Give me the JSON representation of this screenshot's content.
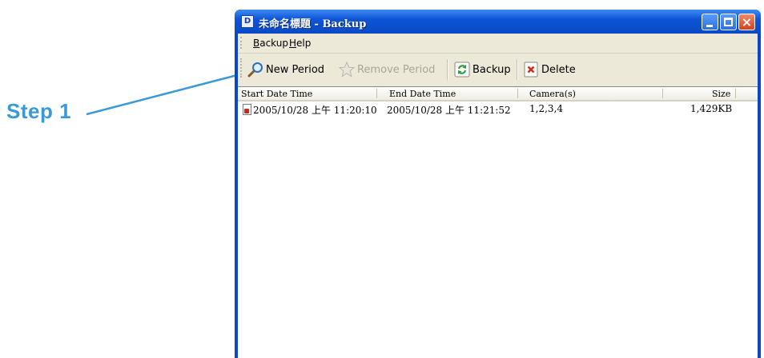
{
  "annotation": {
    "step_label": "Step 1"
  },
  "window": {
    "title": "未命名標題 - Backup",
    "app_icon": "D"
  },
  "menu": {
    "items": [
      {
        "label_accel": "B",
        "label_rest": "ackup"
      },
      {
        "label_accel": "H",
        "label_rest": "elp"
      }
    ]
  },
  "toolbar": {
    "new_period_label": "New Period",
    "remove_period_label": "Remove Period",
    "backup_label": "Backup",
    "delete_label": "Delete",
    "icons": {
      "new_period": "magnifier-icon",
      "remove_period": "star-icon",
      "backup": "refresh-icon",
      "delete": "delete-x-icon"
    }
  },
  "list": {
    "columns": [
      "Start Date Time",
      "End Date Time",
      "Camera(s)",
      "Size"
    ],
    "rows": [
      {
        "start": "2005/10/28 上午 11:20:10",
        "end": "2005/10/28 上午 11:21:52",
        "cameras": "1,2,3,4",
        "size": "1,429KB"
      }
    ]
  },
  "colors": {
    "annotation_blue": "#3a9ad9",
    "titlebar_blue": "#0a49c6",
    "face": "#ece9d8"
  }
}
